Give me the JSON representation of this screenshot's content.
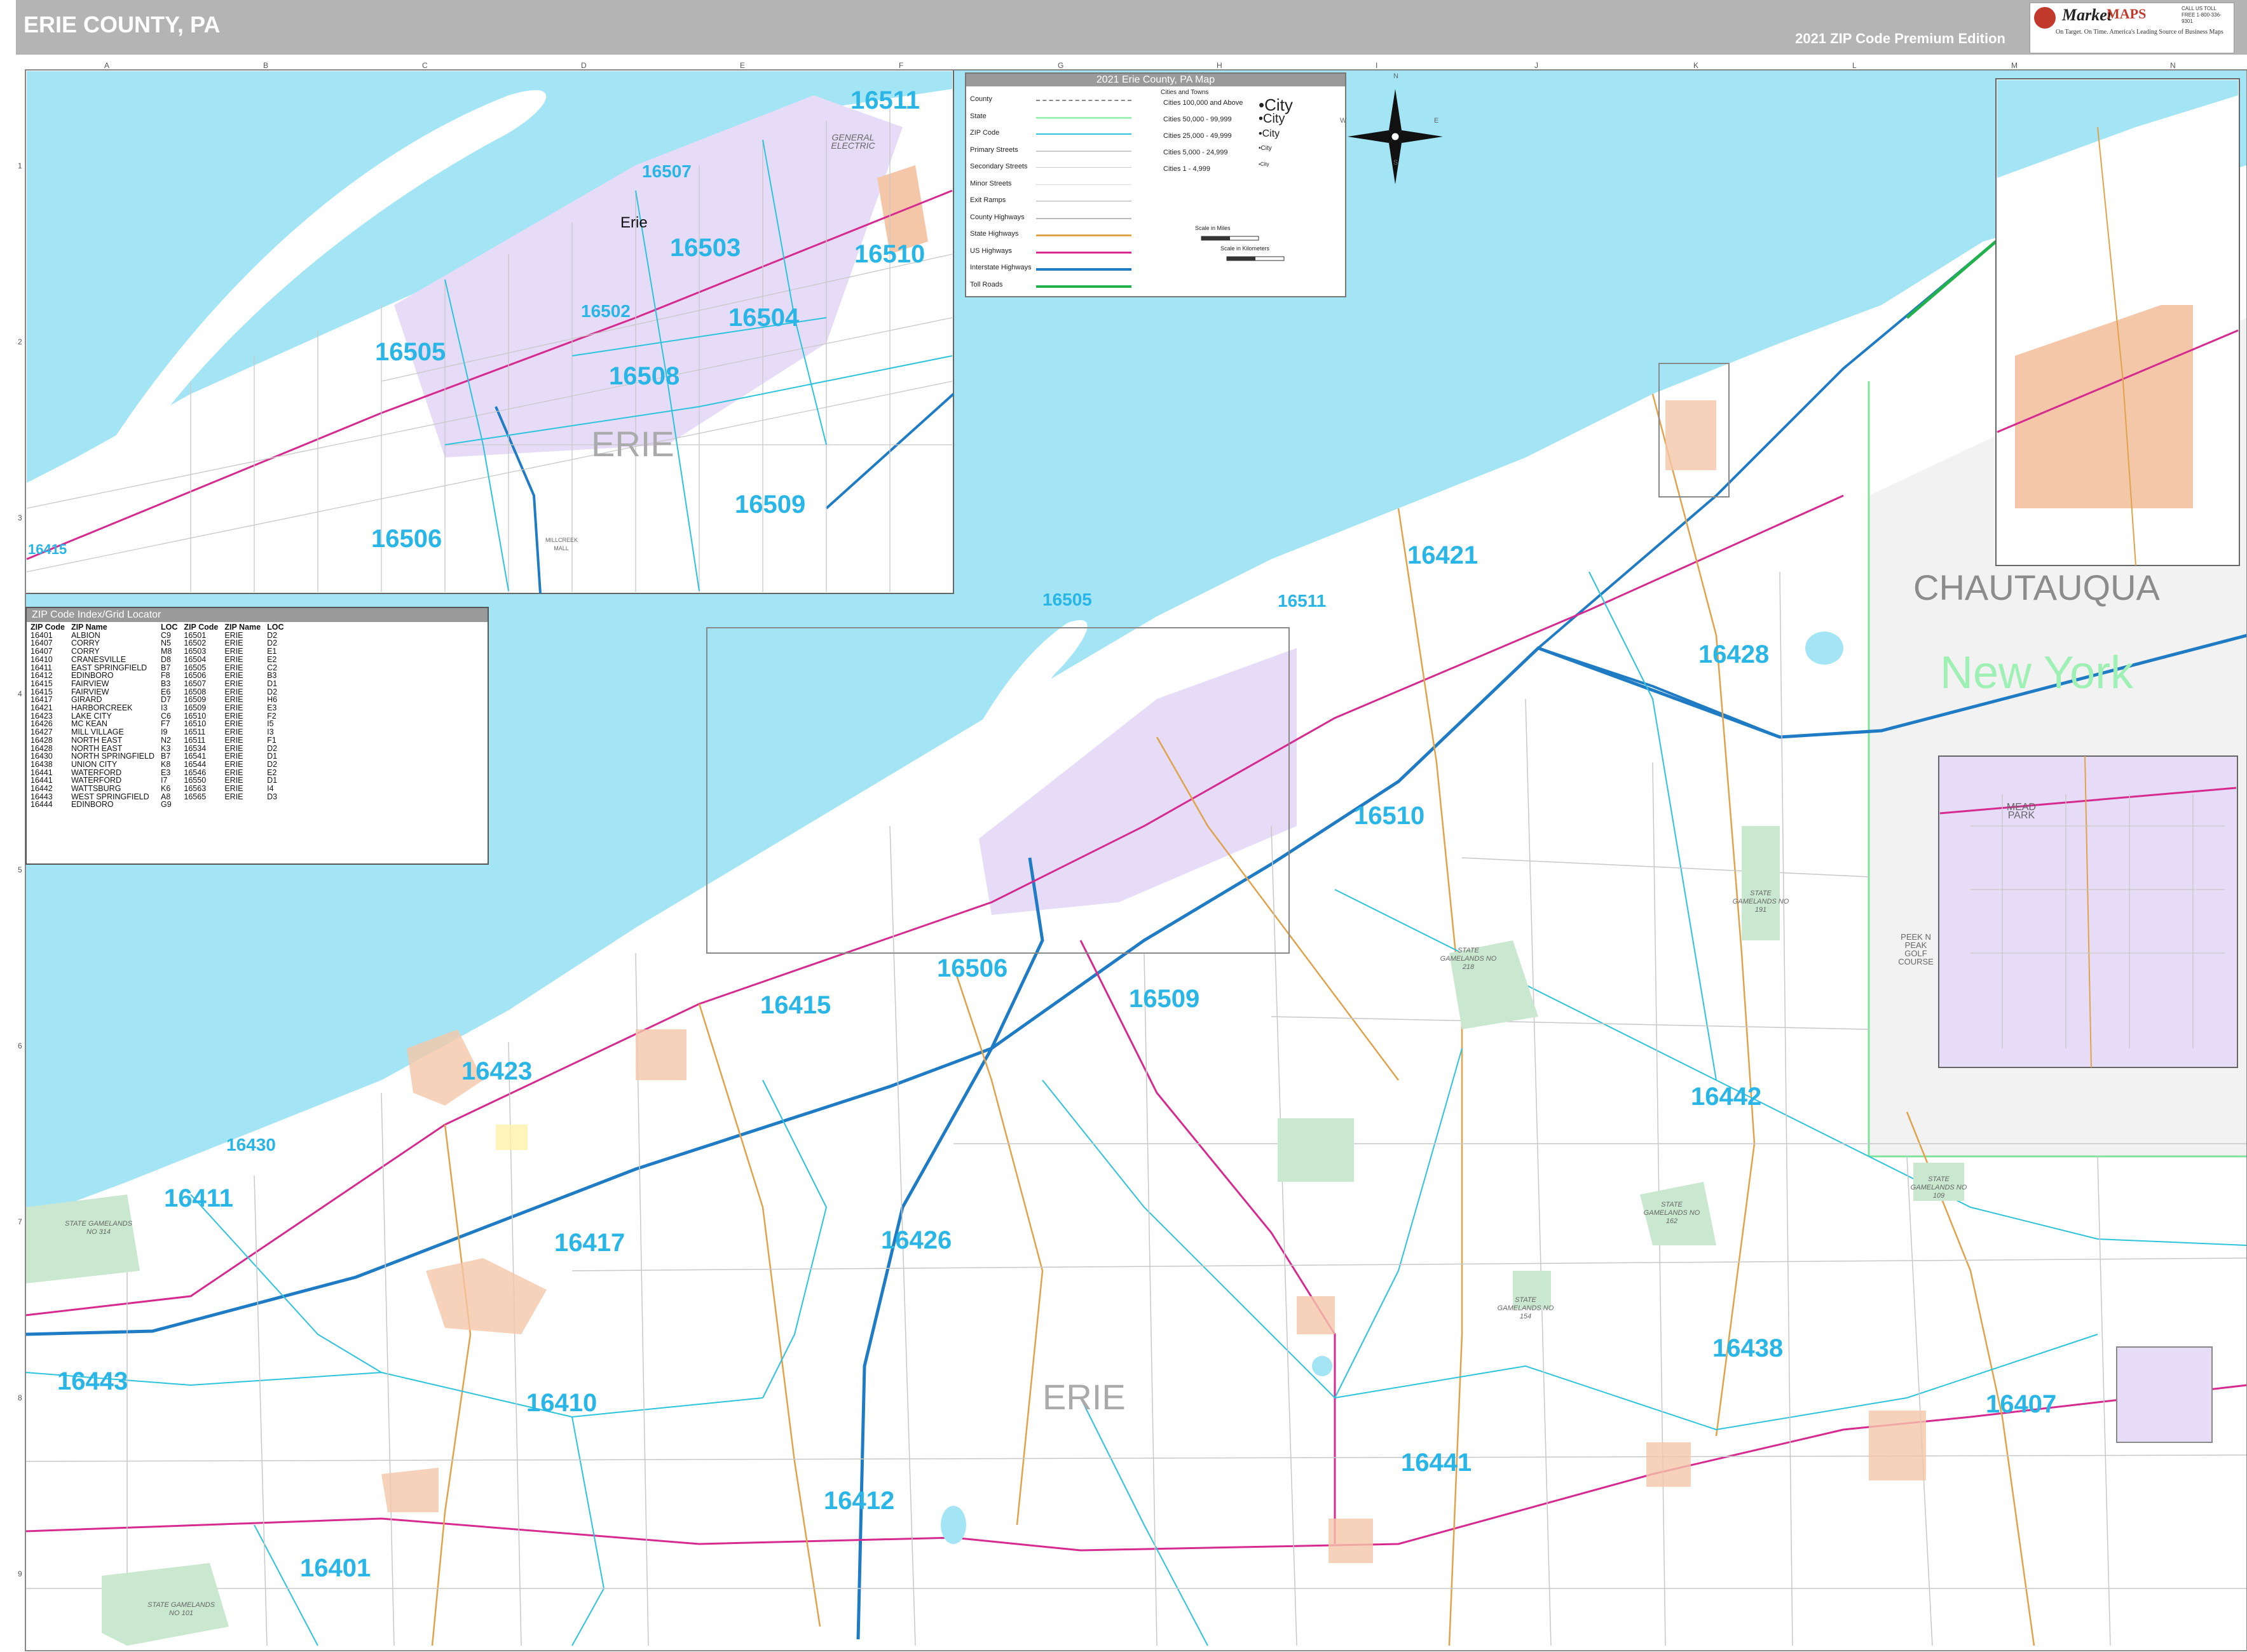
{
  "header": {
    "title": "ERIE COUNTY, PA",
    "edition": "2021 ZIP Code Premium Edition"
  },
  "logo": {
    "word1": "Market",
    "word2": "MAPS",
    "tagline": "On Target. On Time.",
    "subtag": "America's Leading Source of Business Maps",
    "phone": "CALL US TOLL FREE 1-800-336-9301"
  },
  "legend": {
    "title": "2021 Erie County, PA Map",
    "items": [
      "County",
      "State",
      "ZIP Code",
      "Primary Streets",
      "Secondary Streets",
      "Minor Streets",
      "Exit Ramps",
      "County Highways",
      "State Highways",
      "US Highways",
      "Interstate Highways",
      "Toll Roads"
    ],
    "cities_header": "Cities and Towns",
    "city_classes": [
      "Cities 100,000 and Above",
      "Cities 50,000 - 99,999",
      "Cities 25,000 - 49,999",
      "Cities 5,000 - 24,999",
      "Cities 1 - 4,999"
    ],
    "city_samples": [
      "•City",
      "•City",
      "•City",
      "•City",
      "•City"
    ],
    "scale_miles": "Scale in Miles",
    "scale_km": "Scale in Kilometers"
  },
  "zip_index": {
    "title": "ZIP Code Index/Grid Locator",
    "columns": [
      "ZIP Code",
      "ZIP Name",
      "LOC",
      "ZIP Code",
      "ZIP Name",
      "LOC"
    ],
    "rows": [
      [
        "16401",
        "ALBION",
        "C9",
        "16501",
        "ERIE",
        "D2"
      ],
      [
        "16407",
        "CORRY",
        "N5",
        "16502",
        "ERIE",
        "D2"
      ],
      [
        "16407",
        "CORRY",
        "M8",
        "16503",
        "ERIE",
        "E1"
      ],
      [
        "16410",
        "CRANESVILLE",
        "D8",
        "16504",
        "ERIE",
        "E2"
      ],
      [
        "16411",
        "EAST SPRINGFIELD",
        "B7",
        "16505",
        "ERIE",
        "C2"
      ],
      [
        "16412",
        "EDINBORO",
        "F8",
        "16506",
        "ERIE",
        "B3"
      ],
      [
        "16415",
        "FAIRVIEW",
        "B3",
        "16507",
        "ERIE",
        "D1"
      ],
      [
        "16415",
        "FAIRVIEW",
        "E6",
        "16508",
        "ERIE",
        "D2"
      ],
      [
        "16417",
        "GIRARD",
        "D7",
        "16509",
        "ERIE",
        "H6"
      ],
      [
        "16421",
        "HARBORCREEK",
        "I3",
        "16509",
        "ERIE",
        "E3"
      ],
      [
        "16423",
        "LAKE CITY",
        "C6",
        "16510",
        "ERIE",
        "F2"
      ],
      [
        "16426",
        "MC KEAN",
        "F7",
        "16510",
        "ERIE",
        "I5"
      ],
      [
        "16427",
        "MILL VILLAGE",
        "I9",
        "16511",
        "ERIE",
        "I3"
      ],
      [
        "16428",
        "NORTH EAST",
        "N2",
        "16511",
        "ERIE",
        "F1"
      ],
      [
        "16428",
        "NORTH EAST",
        "K3",
        "16534",
        "ERIE",
        "D2"
      ],
      [
        "16430",
        "NORTH SPRINGFIELD",
        "B7",
        "16541",
        "ERIE",
        "D1"
      ],
      [
        "16438",
        "UNION CITY",
        "K8",
        "16544",
        "ERIE",
        "D2"
      ],
      [
        "16441",
        "WATERFORD",
        "E3",
        "16546",
        "ERIE",
        "E2"
      ],
      [
        "16441",
        "WATERFORD",
        "I7",
        "16550",
        "ERIE",
        "D1"
      ],
      [
        "16442",
        "WATTSBURG",
        "K6",
        "16563",
        "ERIE",
        "I4"
      ],
      [
        "16443",
        "WEST SPRINGFIELD",
        "A8",
        "16565",
        "ERIE",
        "D3"
      ],
      [
        "16444",
        "EDINBORO",
        "G9",
        "",
        "",
        ""
      ]
    ]
  },
  "grid": {
    "letters": [
      "A",
      "B",
      "C",
      "D",
      "E",
      "F",
      "G",
      "H",
      "I",
      "J",
      "K",
      "L",
      "M",
      "N"
    ],
    "numbers": [
      "1",
      "2",
      "3",
      "4",
      "5",
      "6",
      "7",
      "8",
      "9"
    ]
  },
  "compass": [
    "N",
    "E",
    "S",
    "W"
  ],
  "inset_erie": {
    "zips": [
      "16511",
      "16507",
      "16503",
      "16510",
      "16502",
      "16504",
      "16505",
      "16508",
      "16509",
      "16506",
      "16415"
    ],
    "city": "Erie",
    "county": "ERIE",
    "places": [
      "GENERAL ELECTRIC",
      "MILLCREEK MALL"
    ]
  },
  "main_map": {
    "zips": [
      "16505",
      "16511",
      "16421",
      "16428",
      "16510",
      "16506",
      "16509",
      "16415",
      "16423",
      "16442",
      "16430",
      "16411",
      "16417",
      "16426",
      "16438",
      "16443",
      "16410",
      "16441",
      "16407",
      "16412",
      "16401"
    ],
    "county": "ERIE",
    "neighbor_county": "CHAUTAUQUA",
    "neighbor_state": "New York",
    "places": [
      "STATE GAMELANDS NO 314",
      "STATE GAMELANDS NO 101",
      "STATE GAMELANDS NO 218",
      "STATE GAMELANDS NO 191",
      "STATE GAMELANDS NO 162",
      "STATE GAMELANDS NO 154",
      "STATE GAMELANDS NO 109"
    ]
  },
  "inset_ne": {
    "places": [
      "MEAD PARK",
      "PEEK N PEAK GOLF COURSE"
    ]
  },
  "colors": {
    "lake": "#a3e4f5",
    "zip_label": "#29b6e6",
    "erie_zone": "#e6dcf7",
    "town": "#f5c7a9",
    "gamelands": "#c9e8cf",
    "interstate": "#1f7cc4",
    "us_highway": "#d62a8f",
    "state_highway": "#e0a24a",
    "toll": "#22b14c",
    "zip_line": "#2cc3dc"
  }
}
